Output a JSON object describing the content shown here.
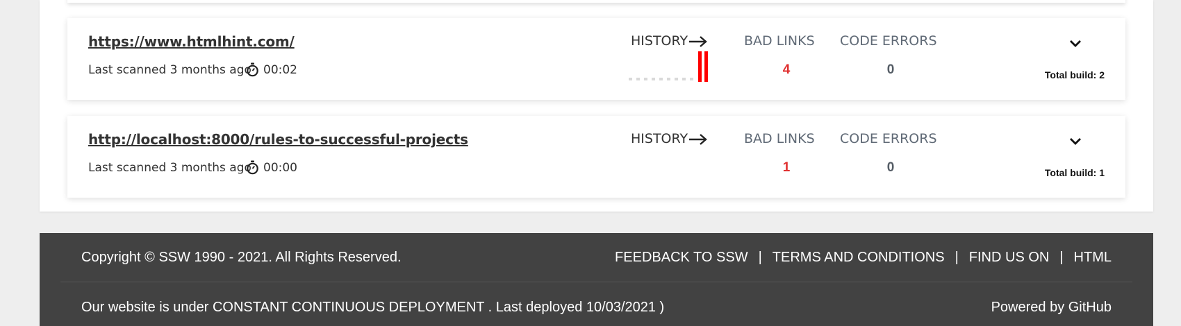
{
  "scans": [
    {
      "url": "https://www.htmlhint.com/",
      "scanned": "Last scanned 3 months ago",
      "duration": "00:02",
      "history_label": "HISTORY",
      "bad_links_label": "BAD LINKS",
      "bad_links": "4",
      "code_errors_label": "CODE ERRORS",
      "code_errors": "0",
      "total_build": "Total build: 2",
      "history": [
        0,
        0,
        0,
        0,
        0,
        0,
        0,
        0,
        0,
        1,
        1
      ]
    },
    {
      "url": "http://localhost:8000/rules-to-successful-projects",
      "scanned": "Last scanned 3 months ago",
      "duration": "00:00",
      "history_label": "HISTORY",
      "bad_links_label": "BAD LINKS",
      "bad_links": "1",
      "code_errors_label": "CODE ERRORS",
      "code_errors": "0",
      "total_build": "Total build: 1",
      "history": []
    }
  ],
  "footer": {
    "copyright": "Copyright © SSW 1990 - 2021. All Rights Reserved.",
    "links": [
      "FEEDBACK TO SSW",
      "TERMS AND CONDITIONS",
      "FIND US ON",
      "HTML"
    ],
    "separator": "|",
    "deploy": "Our website is under CONSTANT CONTINUOUS DEPLOYMENT . Last deployed 10/03/2021 )",
    "powered": "Powered by GitHub"
  },
  "colors": {
    "bad_links": "#e03030",
    "history_bar": "#ff0000",
    "history_empty": "#d9d9d9",
    "footer_bg": "#424242"
  },
  "icons": {
    "timer": "stopwatch-icon",
    "history_arrow": "arrow-right-icon",
    "expand": "chevron-down-icon"
  }
}
